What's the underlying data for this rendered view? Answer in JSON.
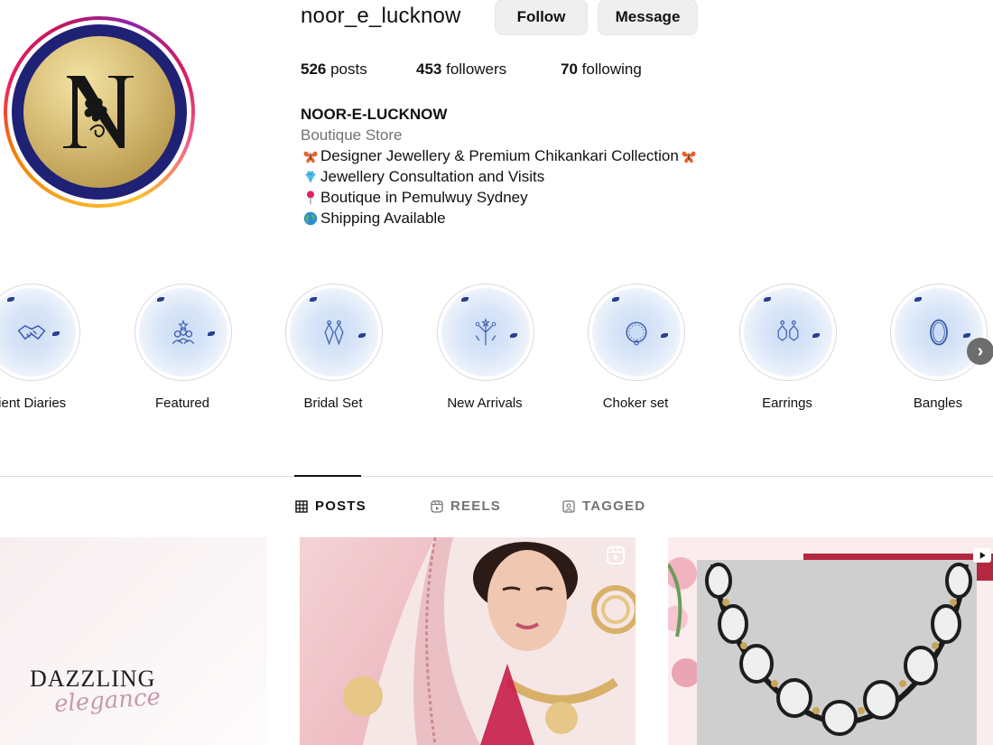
{
  "profile": {
    "username": "noor_e_lucknow",
    "follow_label": "Follow",
    "message_label": "Message",
    "avatar_letter": "N"
  },
  "stats": {
    "posts_count": "526",
    "posts_label": " posts",
    "followers_count": "453",
    "followers_label": " followers",
    "following_count": "70",
    "following_label": " following"
  },
  "bio": {
    "name": "NOOR-E-LUCKNOW",
    "category": "Boutique Store",
    "lines": [
      {
        "icon": "butterfly-icon",
        "text": "Designer Jewellery & Premium Chikankari Collection",
        "trailing_icon": "butterfly-icon"
      },
      {
        "icon": "gem-icon",
        "text": "Jewellery Consultation and Visits"
      },
      {
        "icon": "pushpin-icon",
        "text": "Boutique in Pemulwuy Sydney"
      },
      {
        "icon": "globe-icon",
        "text": "Shipping Available"
      }
    ]
  },
  "highlights": [
    {
      "label": "lient Diaries",
      "icon": "handshake-icon"
    },
    {
      "label": "Featured",
      "icon": "people-stars-icon"
    },
    {
      "label": "Bridal Set",
      "icon": "earrings-icon"
    },
    {
      "label": "New Arrivals",
      "icon": "fireworks-icon"
    },
    {
      "label": "Choker set",
      "icon": "necklace-icon"
    },
    {
      "label": "Earrings",
      "icon": "earrings-icon"
    },
    {
      "label": "Bangles",
      "icon": "bangle-icon"
    }
  ],
  "tabs": [
    {
      "label": "POSTS",
      "icon": "grid-icon",
      "active": true
    },
    {
      "label": "REELS",
      "icon": "reels-icon",
      "active": false
    },
    {
      "label": "TAGGED",
      "icon": "tagged-icon",
      "active": false
    }
  ],
  "posts": [
    {
      "title": "DAZZLING",
      "script": "elegance"
    },
    {
      "badge": "reel-icon"
    },
    {
      "badge": "reel-icon"
    }
  ],
  "colors": {
    "button_bg": "#efefef",
    "muted_text": "#737373",
    "avatar_navy": "#1f2175",
    "avatar_gold": "#d8bf78"
  }
}
